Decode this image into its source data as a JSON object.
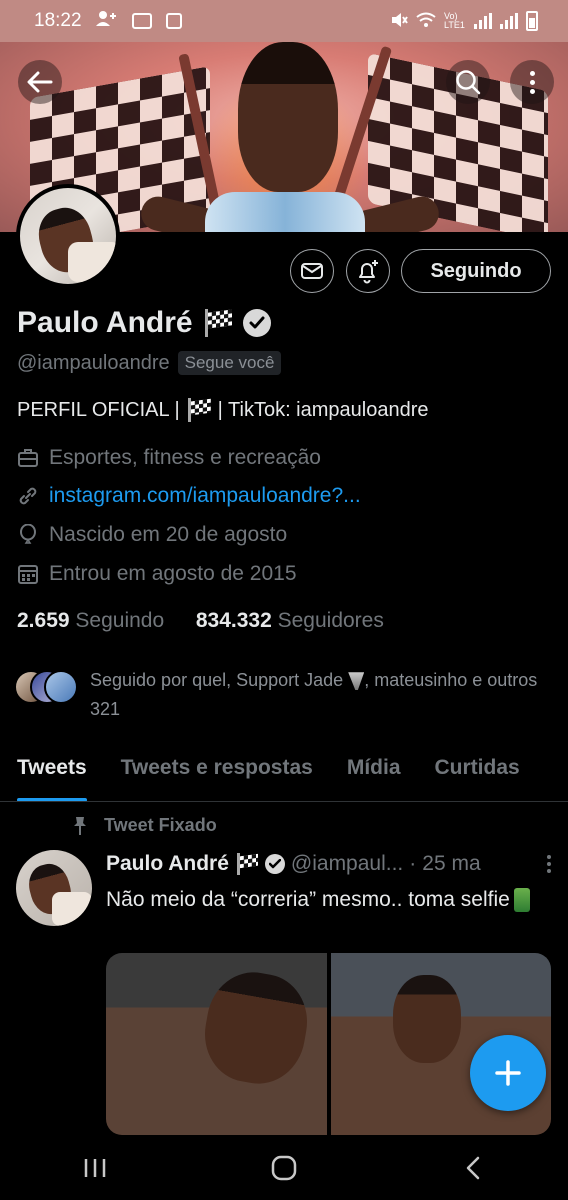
{
  "status_bar": {
    "time": "18:22",
    "network": "Vo) LTE1"
  },
  "profile": {
    "name": "Paulo André",
    "handle": "@iampauloandre",
    "follows_you": "Segue você",
    "bio_prefix": "PERFIL OFICIAL |",
    "bio_suffix": "| TikTok: iampauloandre",
    "category": "Esportes, fitness e recreação",
    "link": "instagram.com/iampauloandre?...",
    "birthday": "Nascido em 20 de agosto",
    "joined": "Entrou em agosto de 2015",
    "following_count": "2.659",
    "following_label": "Seguindo",
    "followers_count": "834.332",
    "followers_label": "Seguidores",
    "followed_by_prefix": "Seguido por quel, Support Jade",
    "followed_by_suffix": ", mateusinho e outros 321"
  },
  "actions": {
    "follow_button_label": "Seguindo"
  },
  "tabs": [
    {
      "label": "Tweets",
      "active": true
    },
    {
      "label": "Tweets e respostas",
      "active": false
    },
    {
      "label": "Mídia",
      "active": false
    },
    {
      "label": "Curtidas",
      "active": false
    }
  ],
  "pinned_tweet": {
    "pinned_label": "Tweet Fixado",
    "author_name": "Paulo André",
    "author_handle": "@iampaul...",
    "separator": "·",
    "time": "25 ma",
    "text": "Não meio da “correria” mesmo.. toma selfie"
  },
  "colors": {
    "accent": "#1d9bf0",
    "background": "#000000",
    "text_primary": "#e7e9ea",
    "text_secondary": "#71767b"
  },
  "icons": {
    "back": "arrow-left-icon",
    "search": "search-icon",
    "more": "more-vertical-icon",
    "mail": "mail-icon",
    "bell": "bell-plus-icon",
    "verified": "verified-badge-icon",
    "flag": "checkered-flag-icon",
    "briefcase": "briefcase-icon",
    "link": "link-icon",
    "balloon": "balloon-icon",
    "calendar": "calendar-icon",
    "pin": "pin-icon",
    "compose": "plus-icon"
  }
}
